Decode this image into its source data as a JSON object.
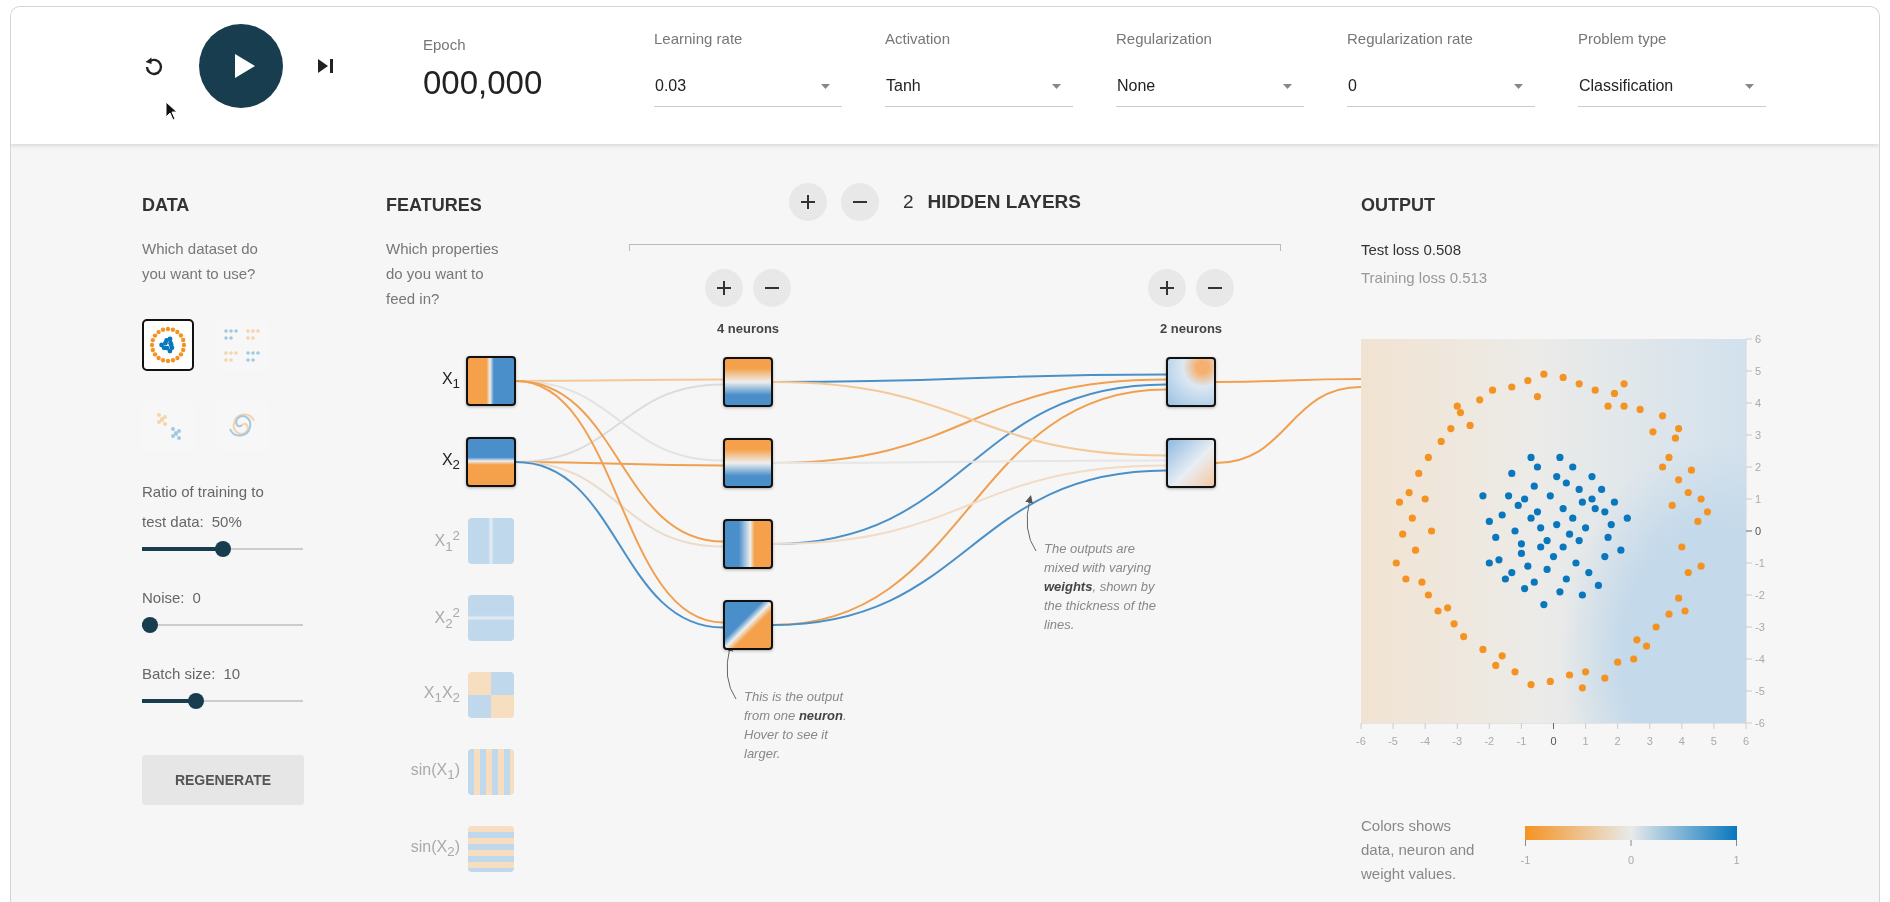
{
  "epoch": {
    "label": "Epoch",
    "value": "000,000"
  },
  "dropdowns": [
    {
      "label": "Learning rate",
      "value": "0.03"
    },
    {
      "label": "Activation",
      "value": "Tanh"
    },
    {
      "label": "Regularization",
      "value": "None"
    },
    {
      "label": "Regularization rate",
      "value": "0"
    },
    {
      "label": "Problem type",
      "value": "Classification"
    }
  ],
  "data": {
    "title": "DATA",
    "description": "Which dataset do you want to use?",
    "datasets": [
      {
        "kind": "circle",
        "selected": true
      },
      {
        "kind": "xor",
        "selected": false
      },
      {
        "kind": "gauss",
        "selected": false
      },
      {
        "kind": "spiral",
        "selected": false
      }
    ],
    "sliders": [
      {
        "label": "Ratio of training to test data:",
        "value": "50%",
        "level": 0.5
      },
      {
        "label": "Noise:",
        "value": "0",
        "level": 0
      },
      {
        "label": "Batch size:",
        "value": "10",
        "level": 0.32
      }
    ],
    "button": "REGENERATE"
  },
  "features": {
    "title": "FEATURES",
    "description": "Which properties do you want to feed in?",
    "items": [
      {
        "label": "X$_{1}$",
        "kind": "x",
        "enabled": true
      },
      {
        "label": "X$_{2}$",
        "kind": "y",
        "enabled": true
      },
      {
        "label": "X$_{1}$$^{2}$",
        "kind": "xsq",
        "enabled": false
      },
      {
        "label": "X$_{2}$$^{2}$",
        "kind": "ysq",
        "enabled": false
      },
      {
        "label": "X$_{1}$X$_{2}$",
        "kind": "xy",
        "enabled": false
      },
      {
        "label": "sin(X$_{1}$)",
        "kind": "sinx",
        "enabled": false
      },
      {
        "label": "sin(X$_{2}$)",
        "kind": "siny",
        "enabled": false
      }
    ]
  },
  "hidden_layers": {
    "count": "2",
    "title": "HIDDEN LAYERS",
    "layers": [
      {
        "label": "4 neurons",
        "neurons": [
          {
            "kind": "yinv",
            "links": [
              {
                "color": "#f5c898"
              },
              {
                "color": "#dcdcdc"
              }
            ]
          },
          {
            "kind": "yinv",
            "links": [
              {
                "color": "#e2e2e2"
              },
              {
                "color": "#f0a050"
              }
            ]
          },
          {
            "kind": "xinv",
            "links": [
              {
                "color": "#f0a050"
              },
              {
                "color": "#eadbcb"
              }
            ]
          },
          {
            "kind": "diag",
            "links": [
              {
                "color": "#f0a050"
              },
              {
                "color": "#4a90c8"
              }
            ]
          }
        ]
      },
      {
        "label": "2 neurons",
        "neurons": [
          {
            "kind": "corner",
            "links": [
              {
                "color": "#4a90c8"
              },
              {
                "color": "#f0a050"
              },
              {
                "color": "#4a90c8"
              },
              {
                "color": "#f0a050"
              }
            ]
          },
          {
            "kind": "diagsoft",
            "links": [
              {
                "color": "#f5c898"
              },
              {
                "color": "#e6e6e6"
              },
              {
                "color": "#f0dcc8"
              },
              {
                "color": "#4a90c8"
              }
            ]
          }
        ]
      }
    ]
  },
  "annotations": [
    {
      "text": "This is the output from one **neuron**. Hover to see it larger."
    },
    {
      "text": "The outputs are mixed with varying **weights**, shown by the thickness of the lines."
    }
  ],
  "output": {
    "title": "OUTPUT",
    "test_loss": "Test loss 0.508",
    "training_loss": "Training loss 0.513",
    "links": [
      {
        "color": "#f0a050"
      },
      {
        "color": "#f0a050"
      }
    ],
    "chart_data": {
      "type": "scatter",
      "xlim": [
        -6,
        6
      ],
      "ylim": [
        -6,
        6
      ],
      "xticks": [
        -6,
        -5,
        -4,
        -3,
        -2,
        -1,
        0,
        1,
        2,
        3,
        4,
        5,
        6
      ],
      "yticks": [
        -6,
        -5,
        -4,
        -3,
        -2,
        -1,
        0,
        1,
        2,
        3,
        4,
        5,
        6
      ],
      "series": [
        {
          "color": "#f59322",
          "x": [
            4.5,
            4.2,
            4.6,
            3.9,
            4.3,
            3.6,
            3.8,
            3.1,
            3.4,
            2.7,
            2.2,
            1.9,
            1.3,
            0.8,
            0.3,
            -0.3,
            -0.8,
            -1.3,
            -1.9,
            -2.3,
            -2.9,
            -3.2,
            -3.5,
            -3.9,
            -4.2,
            -4.5,
            -4.8,
            -4.4,
            -4.7,
            -4.3,
            -4.9,
            -4.1,
            -3.9,
            -3.6,
            -3.1,
            -2.8,
            -2.2,
            -1.8,
            -1.2,
            -0.7,
            -0.1,
            0.5,
            1.0,
            1.6,
            2.0,
            2.5,
            2.9,
            3.2,
            3.6,
            3.9,
            4.2,
            4.6,
            3.7,
            4.0,
            4.8,
            -3.8,
            -4.0,
            -3.3,
            1.7,
            -0.5,
            2.6,
            -2.6,
            3.4,
            -1.6,
            0.9,
            -4.6,
            2.2,
            3.9,
            -3.0,
            4.1
          ],
          "values": [
            0.3,
            1.2,
            1.0,
            1.6,
            1.9,
            2.3,
            2.9,
            3.1,
            3.6,
            3.8,
            3.9,
            4.3,
            4.4,
            4.6,
            4.8,
            4.9,
            4.7,
            4.5,
            4.4,
            4.1,
            3.7,
            3.2,
            2.8,
            2.3,
            1.8,
            1.2,
            0.9,
            0.4,
            -0.1,
            -0.6,
            -1.0,
            -1.6,
            -2.0,
            -2.5,
            -2.9,
            -3.3,
            -3.7,
            -4.2,
            -4.4,
            -4.8,
            -4.7,
            -4.5,
            -4.4,
            -4.6,
            -4.1,
            -4.0,
            -3.6,
            -3.0,
            -2.6,
            -2.1,
            -1.3,
            -1.1,
            0.8,
            -0.5,
            0.6,
            0.0,
            1.0,
            -2.4,
            3.9,
            4.2,
            -3.4,
            3.3,
            2.0,
            -3.9,
            -4.9,
            -1.5,
            4.6,
            3.2,
            3.9,
            -2.5
          ]
        },
        {
          "color": "#0877bd",
          "x": [
            0.1,
            -0.5,
            0.8,
            -1.0,
            1.3,
            -1.4,
            0.4,
            -0.2,
            1.1,
            -1.7,
            0.6,
            -0.7,
            1.8,
            -2.0,
            0.2,
            -0.9,
            1.6,
            -1.2,
            0.9,
            -0.4,
            0.3,
            -0.1,
            1.2,
            -1.5,
            2.1,
            -2.2,
            0.7,
            -0.6,
            1.5,
            -0.3,
            0.5,
            -1.1,
            0.0,
            1.9,
            -1.8,
            0.8,
            -0.8,
            1.4,
            -1.3,
            0.2,
            -0.4,
            0.6,
            -0.9,
            1.0,
            -0.2,
            0.4,
            -1.6,
            1.7,
            -0.6,
            0.1,
            2.3,
            -2.0,
            0.9,
            -0.5,
            1.2,
            -1.0,
            0.3,
            -0.7,
            1.6,
            -1.3
          ],
          "values": [
            0.2,
            0.6,
            -0.3,
            -0.4,
            0.7,
            1.1,
            1.5,
            -1.2,
            -1.3,
            -0.9,
            2.0,
            2.3,
            0.2,
            0.3,
            -1.9,
            -1.8,
            -0.8,
            0.0,
            0.9,
            -0.5,
            0.7,
            1.1,
            1.7,
            -1.5,
            -0.6,
            1.1,
            -1.0,
            1.4,
            1.3,
            -2.3,
            -0.1,
            0.8,
            -0.8,
            0.9,
            -0.2,
            1.3,
            -1.1,
            -1.7,
            1.8,
            2.3,
            0.1,
            0.4,
            1.0,
            0.1,
            -0.3,
            -1.5,
            0.5,
            -0.2,
            -1.6,
            1.7,
            0.4,
            -1.0,
            -2.0,
            2.0,
            1.0,
            -0.7,
            -0.5,
            0.4,
            0.6,
            -1.3
          ]
        }
      ]
    },
    "legend": {
      "text": "Colors shows data, neuron and weight values.",
      "ticks": [
        "-1",
        "0",
        "1"
      ]
    }
  }
}
